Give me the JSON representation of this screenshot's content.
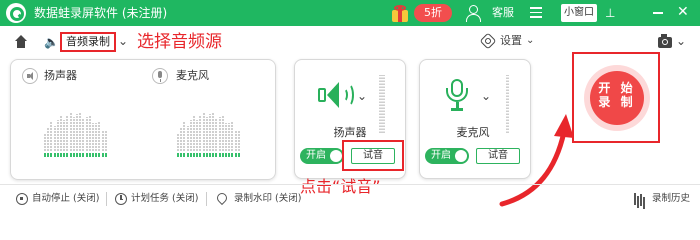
{
  "titlebar": {
    "title": "数据蛙录屏软件 (未注册)",
    "promo_badge": "5折",
    "service_label": "客服",
    "mini_window_label": "小窗口",
    "pin_glyph": "⊥",
    "close_glyph": "✕"
  },
  "toolbar": {
    "audio_source": "音频录制",
    "annotation_select_source": "选择音频源",
    "settings_label": "设置"
  },
  "left_panel": {
    "speaker_label": "扬声器",
    "mic_label": "麦克风"
  },
  "speaker_card": {
    "label": "扬声器",
    "toggle_label": "开启",
    "test_label": "试音"
  },
  "mic_card": {
    "label": "麦克风",
    "toggle_label": "开启",
    "test_label": "试音"
  },
  "annotation_click_test": "点击“试音”",
  "record_button": {
    "line1": "开 始",
    "line2": "录 制"
  },
  "footer": {
    "auto_stop": "自动停止 (关闭)",
    "schedule": "计划任务 (关闭)",
    "watermark": "录制水印 (关闭)",
    "history": "录制历史"
  },
  "colors": {
    "brand_green": "#1fb761",
    "accent_red": "#e8262b",
    "record_red": "#f04848"
  }
}
